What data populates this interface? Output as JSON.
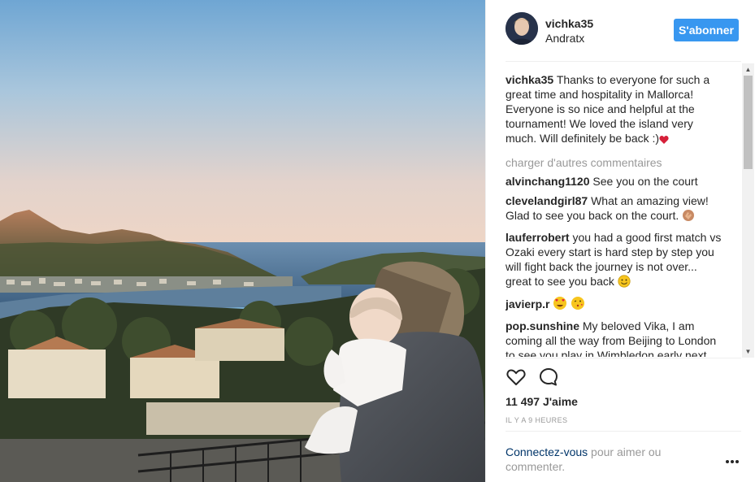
{
  "post": {
    "photo_alt": "Parent holding a baby on a balcony overlooking the bay of Port d'Andratx at sunset"
  },
  "header": {
    "username": "vichka35",
    "location": "Andratx",
    "follow_label": "S'abonner"
  },
  "caption": {
    "author": "vichka35",
    "text": "Thanks to everyone for such a great time and hospitality in Mallorca! Everyone is so nice and helpful at the tournament! We loved the island very much. Will definitely be back :)",
    "emoji_icon": "heart-icon"
  },
  "load_more_label": "charger d'autres commentaires",
  "comments": [
    {
      "author": "alvinchang1120",
      "text": "See you on the court"
    },
    {
      "author": "clevelandgirl87",
      "text": "What an amazing view! Glad to see you back on the court.",
      "emoji_icon": "clapping-hands-icon"
    },
    {
      "author": "lauferrobert",
      "text": "you had a good first match vs Ozaki every start is hard step by step you will fight back the journey is not over... great to see you back",
      "emoji_icon": "smiley-icon"
    },
    {
      "author": "javierp.r",
      "text": "",
      "emoji_icons": [
        "heart-eyes-icon",
        "kiss-icon"
      ]
    },
    {
      "author": "pop.sunshine",
      "text": "My beloved Vika, I am coming all the way from Beijing to London to see you play in Wimbledon early next week, I am wondering if there is a possibility"
    }
  ],
  "actions": {
    "like_icon": "heart-outline-icon",
    "comment_icon": "speech-bubble-icon"
  },
  "likes_label": "11 497 J'aime",
  "time_label": "IL Y A 9 HEURES",
  "login": {
    "link_label": "Connectez-vous",
    "rest_label": " pour aimer ou commenter."
  },
  "colors": {
    "accent": "#3897f0",
    "link": "#003569",
    "muted": "#999999",
    "text": "#262626"
  }
}
